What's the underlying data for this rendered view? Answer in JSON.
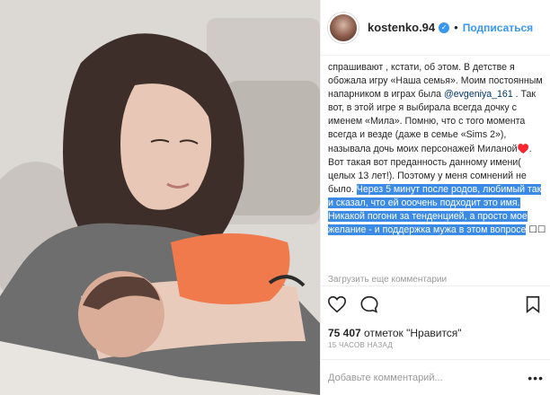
{
  "post": {
    "username": "kostenko.94",
    "verified_icon": "verified-badge-icon",
    "separator": "•",
    "follow_label": "Подписаться",
    "caption": {
      "part1": "спрашивают , кстати, об этом. В детстве я обожала игру «Наша семья». Моим постоянным напарником в играх была ",
      "mention": "@evgeniya_161",
      "part2": " . Так вот, в этой игре я выбирала всегда дочку с именем «Мила». Помню, что с того момента всегда и везде (даже в семье «Sims 2»), называла дочь моих персонажей Миланой♥️. Вот такая вот преданность данному имени( целых 13 лет!). Поэтому у меня сомнений не было. ",
      "selected": "Через 5 минут после родов, любимый так и сказал, что ей ооочень подходит это имя. Никакой погони за тенденцией, а просто мое желание - и поддержка мужа в этом вопросе",
      "tail": " ☐☐"
    },
    "load_more": "Загрузить еще комментарии",
    "likes_count": "75 407",
    "likes_text": "отметок \"Нравится\"",
    "time": "15 часов назад",
    "comment_placeholder": "Добавьте комментарий...",
    "more_options": "•••",
    "icons": {
      "like": "heart-icon",
      "comment": "comment-icon",
      "save": "bookmark-icon"
    }
  }
}
